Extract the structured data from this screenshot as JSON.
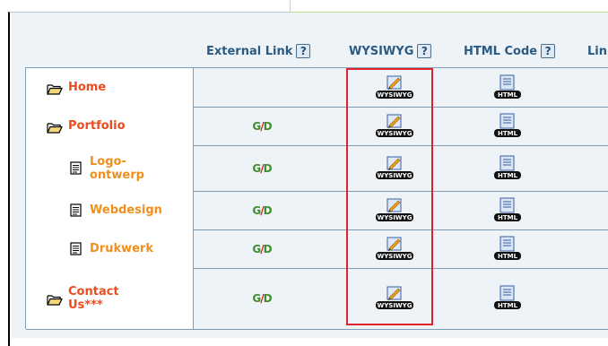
{
  "columns": {
    "external": "External Link",
    "wysiwyg": "WYSIWYG",
    "html": "HTML Code",
    "link_partial": "Lin",
    "help": "?"
  },
  "icons": {
    "external_link_label": "G/D",
    "wysiwyg_label": "WYSIWYG",
    "html_label": "HTML"
  },
  "pages": [
    {
      "label": "Home",
      "type": "folder",
      "level": 0,
      "has_external": false
    },
    {
      "label": "Portfolio",
      "type": "folder",
      "level": 0,
      "has_external": true
    },
    {
      "label": "Logo-ontwerp",
      "type": "page",
      "level": 1,
      "has_external": true,
      "line1": "Logo-",
      "line2": "ontwerp"
    },
    {
      "label": "Webdesign",
      "type": "page",
      "level": 1,
      "has_external": true
    },
    {
      "label": "Drukwerk",
      "type": "page",
      "level": 1,
      "has_external": true
    },
    {
      "label": "Contact Us***",
      "type": "folder",
      "level": 0,
      "has_external": true,
      "line1": "Contact",
      "line2": "Us***"
    }
  ],
  "colors": {
    "folder_text": "#e84c1f",
    "page_text": "#f08f1d",
    "header_text": "#2b5a82",
    "highlight": "#e0232b",
    "panel": "#eef3f8"
  }
}
